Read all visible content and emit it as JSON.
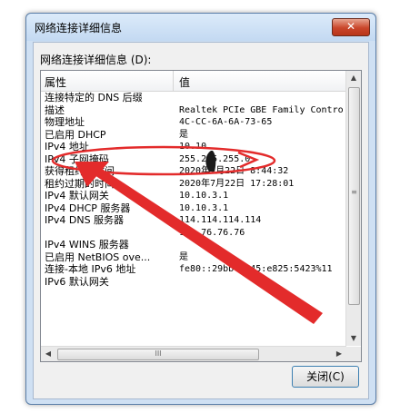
{
  "dialog": {
    "title": "网络连接详细信息",
    "close_glyph": "✕",
    "caption": "网络连接详细信息 (D):",
    "close_button_label": "关闭(C)"
  },
  "table": {
    "columns": [
      "属性",
      "值"
    ],
    "rows": [
      {
        "name": "连接特定的 DNS 后缀",
        "value": ""
      },
      {
        "name": "描述",
        "value": "Realtek PCIe GBE Family Contro"
      },
      {
        "name": "物理地址",
        "value": "4C-CC-6A-6A-73-65"
      },
      {
        "name": "已启用 DHCP",
        "value": "是"
      },
      {
        "name": "IPv4 地址",
        "value": "10.10."
      },
      {
        "name": "IPv4 子网掩码",
        "value": "255.255.255.0"
      },
      {
        "name": "获得租约的时间",
        "value": "2020年7月22日 8:44:32"
      },
      {
        "name": "租约过期的时间",
        "value": "2020年7月22日 17:28:01"
      },
      {
        "name": "IPv4 默认网关",
        "value": "10.10.3.1"
      },
      {
        "name": "IPv4 DHCP 服务器",
        "value": "10.10.3.1"
      },
      {
        "name": "IPv4 DNS 服务器",
        "value": "114.114.114.114"
      },
      {
        "name": "",
        "value": "180.76.76.76"
      },
      {
        "name": "IPv4 WINS 服务器",
        "value": ""
      },
      {
        "name": "已启用 NetBIOS ove...",
        "value": "是"
      },
      {
        "name": "连接-本地 IPv6 地址",
        "value": "fe80::29bb:c345:e825:5423%11"
      },
      {
        "name": "IPv6 默认网关",
        "value": ""
      }
    ]
  },
  "scroll": {
    "up_arrow": "▲",
    "down_arrow": "▼",
    "left_arrow": "◀",
    "right_arrow": "▶",
    "thumb_grip": "III",
    "vthumb_grip": "≡"
  },
  "colors": {
    "annotation_red": "#e32b2b"
  }
}
